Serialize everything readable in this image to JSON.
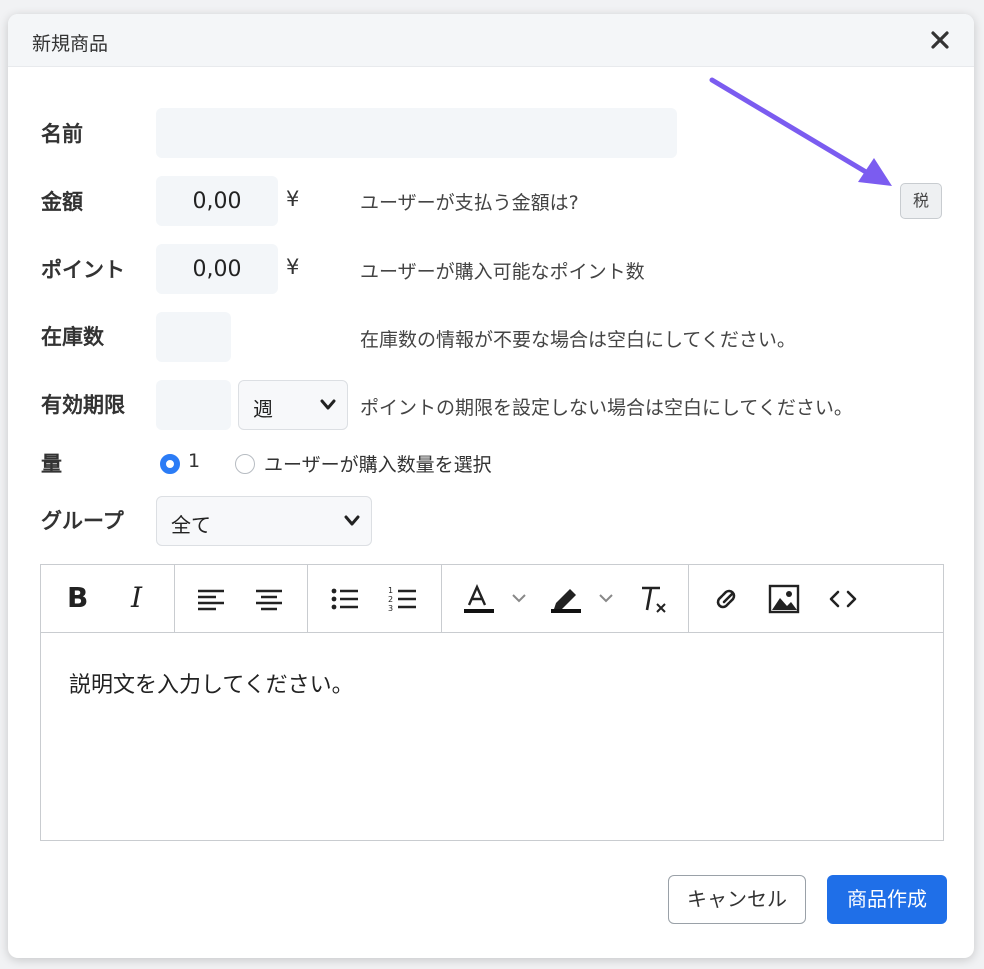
{
  "dialog": {
    "title": "新規商品",
    "close_icon": "close-icon"
  },
  "form": {
    "name": {
      "label": "名前",
      "value": ""
    },
    "amount": {
      "label": "金額",
      "value": "0,00",
      "unit": "¥",
      "hint": "ユーザーが支払う金額は?"
    },
    "points": {
      "label": "ポイント",
      "value": "0,00",
      "unit": "¥",
      "hint": "ユーザーが購入可能なポイント数"
    },
    "stock": {
      "label": "在庫数",
      "value": "",
      "hint": "在庫数の情報が不要な場合は空白にしてください。"
    },
    "expiry": {
      "label": "有効期限",
      "value": "",
      "period": "週",
      "hint": "ポイントの期限を設定しない場合は空白にしてください。"
    },
    "quantity": {
      "label": "量",
      "option_fixed": "1",
      "option_user": "ユーザーが購入数量を選択",
      "selected": "1"
    },
    "group": {
      "label": "グループ",
      "value": "全て"
    },
    "tax_button": "税"
  },
  "editor": {
    "toolbar": [
      "bold-icon",
      "italic-icon",
      "align-left-icon",
      "align-center-icon",
      "bullet-list-icon",
      "numbered-list-icon",
      "text-color-icon",
      "highlight-icon",
      "clear-format-icon",
      "link-icon",
      "image-icon",
      "code-icon"
    ],
    "bold": "B",
    "italic": "I",
    "body": "説明文を入力してください。"
  },
  "footer": {
    "cancel": "キャンセル",
    "create": "商品作成"
  },
  "colors": {
    "primary": "#1f6fe8",
    "arrow": "#7b5cf0",
    "field_bg": "#f3f6f9"
  }
}
